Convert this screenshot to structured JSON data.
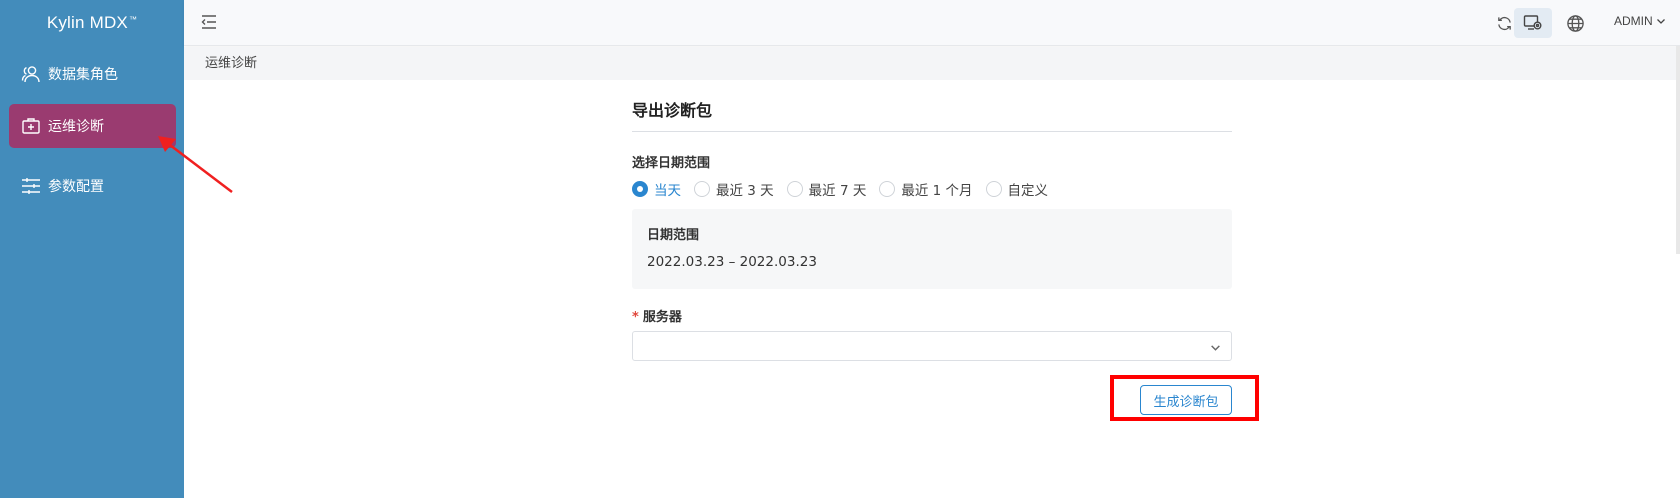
{
  "app": {
    "title": "Kylin MDX",
    "title_mark": "™"
  },
  "sidebar": {
    "items": [
      {
        "label": "数据集角色",
        "icon": "user-group-icon",
        "active": false
      },
      {
        "label": "运维诊断",
        "icon": "medical-kit-icon",
        "active": true
      },
      {
        "label": "参数配置",
        "icon": "sliders-icon",
        "active": false
      }
    ]
  },
  "header": {
    "icons": [
      "menu-collapse-icon",
      "refresh-icon",
      "monitor-settings-icon",
      "globe-icon"
    ],
    "user": "ADMIN"
  },
  "breadcrumb": {
    "current": "运维诊断"
  },
  "export": {
    "title": "导出诊断包",
    "date_range_label": "选择日期范围",
    "options": [
      "当天",
      "最近 3 天",
      "最近 7 天",
      "最近 1 个月",
      "自定义"
    ],
    "selected": "当天",
    "range_title": "日期范围",
    "range_value": "2022.03.23 – 2022.03.23",
    "server_label": "服务器",
    "server_required_mark": "*",
    "server_value": "",
    "generate_button": "生成诊断包"
  },
  "colors": {
    "sidebar": "#438cbb",
    "active_item": "#9a3b70",
    "accent": "#2a86cf",
    "annotation": "#ff0000"
  }
}
